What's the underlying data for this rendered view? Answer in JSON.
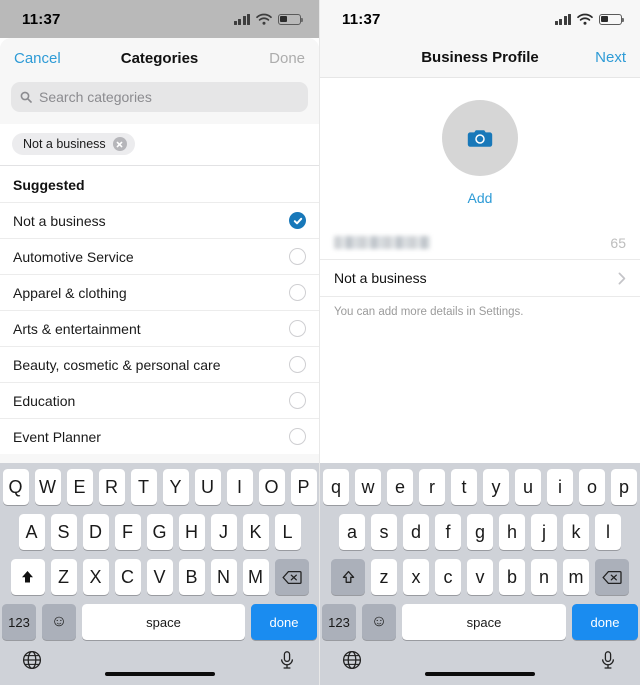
{
  "left": {
    "status_bar": {
      "time": "11:37",
      "signal_icon": "cellular-bars-icon",
      "wifi_icon": "wifi-icon",
      "battery_icon": "battery-icon"
    },
    "nav": {
      "cancel_label": "Cancel",
      "title": "Categories",
      "done_label": "Done"
    },
    "search": {
      "placeholder": "Search categories",
      "icon": "search-icon"
    },
    "chips": [
      {
        "label": "Not a business",
        "remove_icon": "close-circle-icon"
      }
    ],
    "section_header": "Suggested",
    "categories": [
      {
        "label": "Not a business",
        "selected": true
      },
      {
        "label": "Automotive Service",
        "selected": false
      },
      {
        "label": "Apparel & clothing",
        "selected": false
      },
      {
        "label": "Arts & entertainment",
        "selected": false
      },
      {
        "label": "Beauty, cosmetic & personal care",
        "selected": false
      },
      {
        "label": "Education",
        "selected": false
      },
      {
        "label": "Event Planner",
        "selected": false
      }
    ],
    "keyboard": {
      "row1": [
        "Q",
        "W",
        "E",
        "R",
        "T",
        "Y",
        "U",
        "I",
        "O",
        "P"
      ],
      "row2": [
        "A",
        "S",
        "D",
        "F",
        "G",
        "H",
        "J",
        "K",
        "L"
      ],
      "row3": [
        "Z",
        "X",
        "C",
        "V",
        "B",
        "N",
        "M"
      ],
      "shift_icon": "shift-filled-icon",
      "backspace_icon": "backspace-icon",
      "numbers_label": "123",
      "emoji_icon": "emoji-icon",
      "space_label": "space",
      "return_label": "done",
      "globe_icon": "globe-icon",
      "mic_icon": "microphone-icon"
    }
  },
  "right": {
    "status_bar": {
      "time": "11:37",
      "signal_icon": "cellular-bars-icon",
      "wifi_icon": "wifi-icon",
      "battery_icon": "battery-icon"
    },
    "nav": {
      "title": "Business Profile",
      "next_label": "Next"
    },
    "avatar": {
      "icon": "camera-icon",
      "add_label": "Add"
    },
    "name_field": {
      "value": "",
      "char_counter": "65",
      "redacted": true
    },
    "category_row": {
      "label": "Not a business",
      "chevron_icon": "chevron-right-icon"
    },
    "hint": "You can add more details in Settings.",
    "keyboard": {
      "row1": [
        "q",
        "w",
        "e",
        "r",
        "t",
        "y",
        "u",
        "i",
        "o",
        "p"
      ],
      "row2": [
        "a",
        "s",
        "d",
        "f",
        "g",
        "h",
        "j",
        "k",
        "l"
      ],
      "row3": [
        "z",
        "x",
        "c",
        "v",
        "b",
        "n",
        "m"
      ],
      "shift_icon": "shift-outline-icon",
      "backspace_icon": "backspace-icon",
      "numbers_label": "123",
      "emoji_icon": "emoji-icon",
      "space_label": "space",
      "return_label": "done",
      "globe_icon": "globe-icon",
      "mic_icon": "microphone-icon"
    }
  },
  "colors": {
    "accent_blue": "#2e9bd6",
    "key_blue": "#1a8cf0",
    "check_blue": "#1878b9",
    "keyboard_bg": "#cfd2d8"
  }
}
